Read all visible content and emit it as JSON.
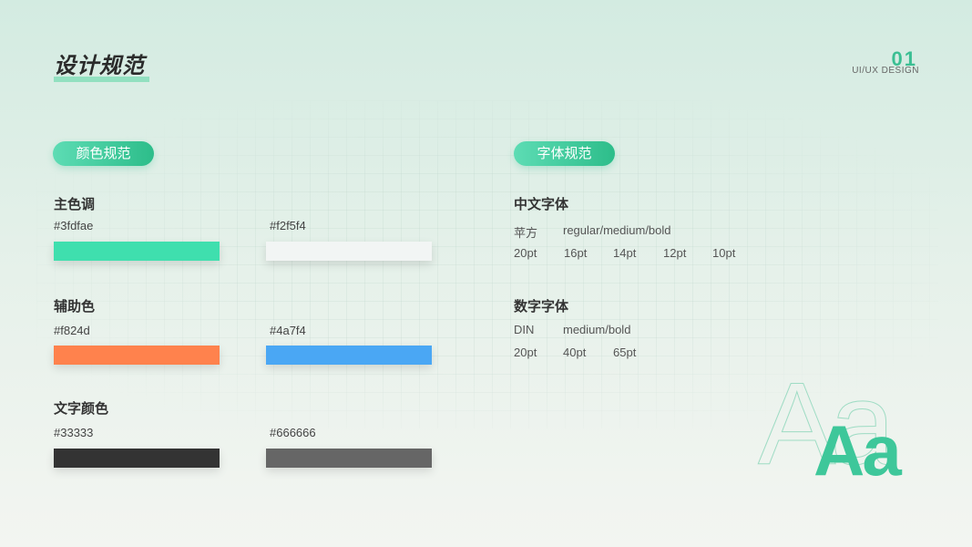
{
  "header": {
    "title": "设计规范",
    "page_number": "01",
    "page_subtitle": "UI/UX DESIGN"
  },
  "colors_section": {
    "pill_label": "颜色规范",
    "main": {
      "label": "主色调",
      "swatches": [
        {
          "hex_label": "#3fdfae",
          "color": "#3fdfae"
        },
        {
          "hex_label": "#f2f5f4",
          "color": "#f2f5f4"
        }
      ]
    },
    "auxiliary": {
      "label": "辅助色",
      "swatches": [
        {
          "hex_label": "#f824d",
          "color": "#ff824d"
        },
        {
          "hex_label": "#4a7f4",
          "color": "#4aa7f4"
        }
      ]
    },
    "text": {
      "label": "文字颜色",
      "swatches": [
        {
          "hex_label": "#33333",
          "color": "#333333"
        },
        {
          "hex_label": "#666666",
          "color": "#666666"
        }
      ]
    }
  },
  "fonts_section": {
    "pill_label": "字体规范",
    "chinese": {
      "label": "中文字体",
      "family": "苹方",
      "weights": "regular/medium/bold",
      "sizes": [
        "20pt",
        "16pt",
        "14pt",
        "12pt",
        "10pt"
      ]
    },
    "numeric": {
      "label": "数字字体",
      "family": "DIN",
      "weights": "medium/bold",
      "sizes": [
        "20pt",
        "40pt",
        "65pt"
      ]
    },
    "sample_text": "Aa"
  }
}
